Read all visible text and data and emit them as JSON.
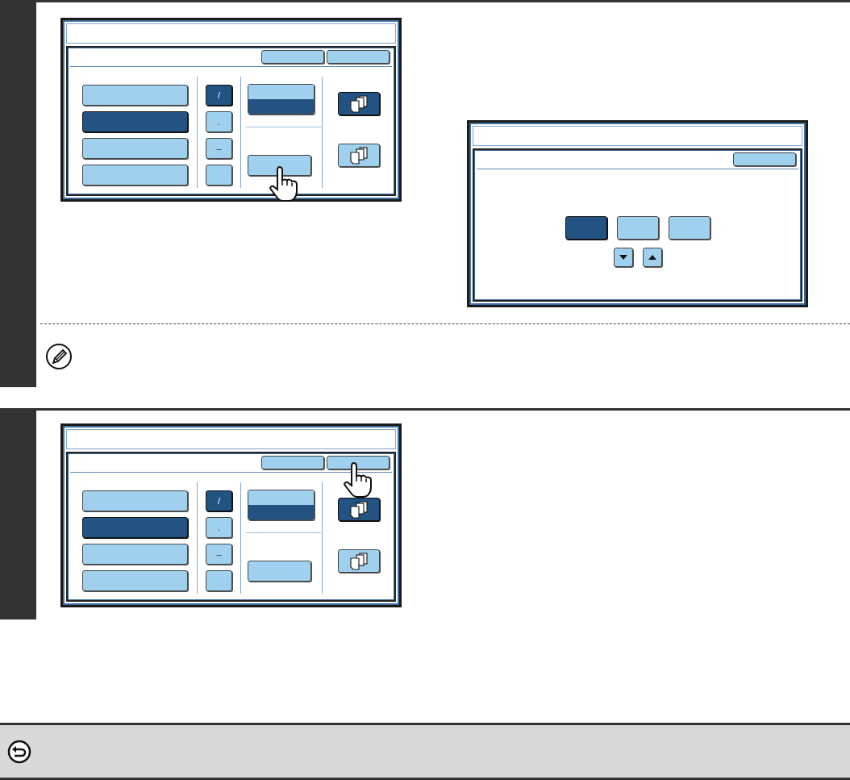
{
  "steps": [
    {
      "screen": {
        "header_buttons": [
          {
            "touched": false
          },
          {
            "touched": false
          }
        ],
        "options": [
          {
            "selected": false
          },
          {
            "selected": true
          },
          {
            "selected": false
          },
          {
            "selected": false
          }
        ],
        "keys": [
          {
            "label": "/",
            "selected": true
          },
          {
            "label": ".",
            "selected": false
          },
          {
            "label": "–",
            "selected": false
          },
          {
            "selected": false
          }
        ],
        "toggle": [
          {
            "selected": false
          },
          {
            "selected": true
          }
        ],
        "action_button": {
          "touched": true
        },
        "sort_buttons": [
          {
            "selected": true
          },
          {
            "selected": false
          }
        ]
      },
      "dialog": {
        "header_buttons": [
          {
            "touched": false
          }
        ],
        "options": [
          {
            "selected": true
          },
          {
            "selected": false
          },
          {
            "selected": false
          }
        ],
        "arrows": [
          {
            "kind": "down"
          },
          {
            "kind": "up"
          }
        ]
      },
      "has_note": true
    },
    {
      "screen": {
        "header_buttons": [
          {
            "touched": false
          },
          {
            "touched": true
          }
        ],
        "options": [
          {
            "selected": false
          },
          {
            "selected": true
          },
          {
            "selected": false
          },
          {
            "selected": false
          }
        ],
        "keys": [
          {
            "label": "/",
            "selected": true
          },
          {
            "label": ".",
            "selected": false
          },
          {
            "label": "–",
            "selected": false
          },
          {
            "selected": false
          }
        ],
        "toggle": [
          {
            "selected": false
          },
          {
            "selected": true
          }
        ],
        "action_button": {
          "touched": false
        },
        "sort_buttons": [
          {
            "selected": true
          },
          {
            "selected": false
          }
        ]
      },
      "has_note": false
    }
  ]
}
